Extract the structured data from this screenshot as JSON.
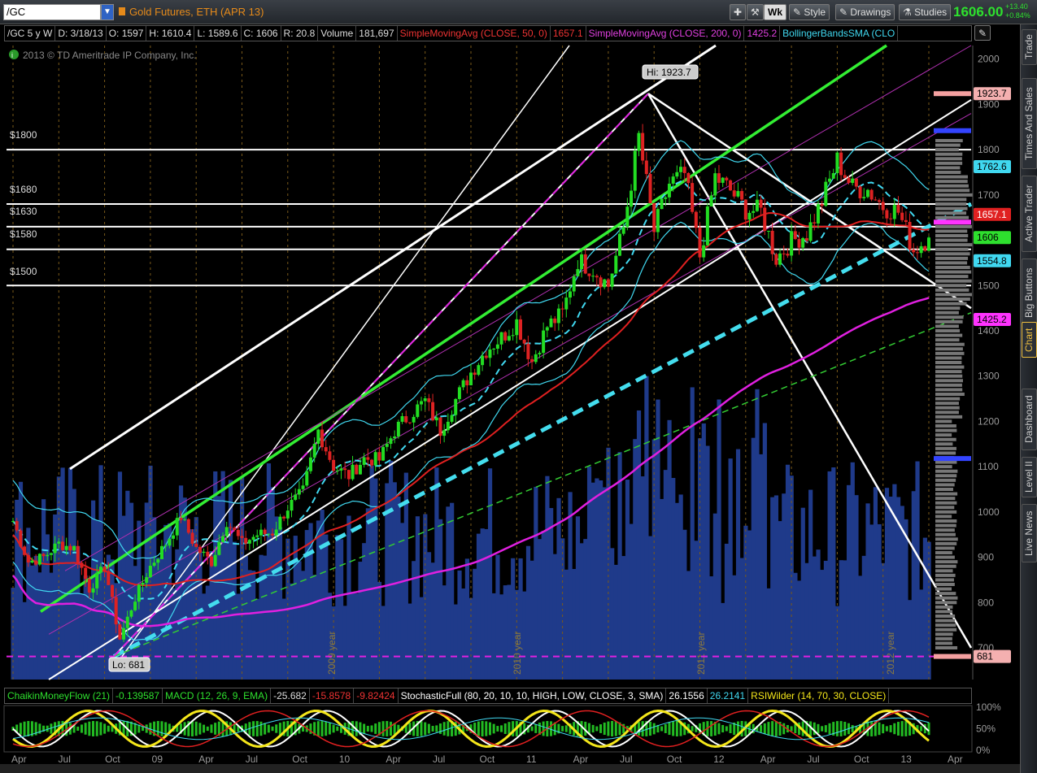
{
  "header": {
    "symbol": "/GC",
    "description": "Gold Futures, ETH (APR 13)",
    "wk_label": "Wk",
    "style_label": "Style",
    "drawings_label": "Drawings",
    "studies_label": "Studies",
    "last_price": "1606.00",
    "change_abs": "+13.40",
    "change_pct": "+0.84%"
  },
  "studies": {
    "symbol_period": "/GC 5 y W",
    "date": "D: 3/18/13",
    "open": "O: 1597",
    "high": "H: 1610.4",
    "low": "L: 1589.6",
    "close": "C: 1606",
    "range": "R: 20.8",
    "volume_label": "Volume",
    "volume_value": "181,697",
    "sma50_label": "SimpleMovingAvg (CLOSE, 50, 0)",
    "sma50_value": "1657.1",
    "sma200_label": "SimpleMovingAvg (CLOSE, 200, 0)",
    "sma200_value": "1425.2",
    "bb_label": "BollingerBandsSMA (CLO"
  },
  "copyright": "2013 © TD Ameritrade IP Company, Inc.",
  "lower_studies": {
    "cmf_label": "ChaikinMoneyFlow (21)",
    "cmf_value": "-0.139587",
    "macd_label": "MACD (12, 26, 9, EMA)",
    "macd_v1": "-25.682",
    "macd_v2": "-15.8578",
    "macd_v3": "-9.82424",
    "stoch_label": "StochasticFull (80, 20, 10, 10, HIGH, LOW, CLOSE, 3, SMA)",
    "stoch_v1": "26.1556",
    "stoch_v2": "26.2141",
    "rsi_label": "RSIWilder (14, 70, 30, CLOSE)",
    "lower_axis": [
      "100%",
      "50%",
      "0%"
    ]
  },
  "sidebar_tabs": [
    "Trade",
    "Times And Sales",
    "Active Trader",
    "Big Buttons",
    "Chart",
    "Dashboard",
    "Level II",
    "Live News"
  ],
  "price_axis": [
    "2000",
    "1900",
    "1800",
    "1700",
    "1600",
    "1500",
    "1400",
    "1300",
    "1200",
    "1100",
    "1000",
    "900",
    "800",
    "700"
  ],
  "price_tags": {
    "high": "1923.7",
    "bb_upper": "1762.6",
    "sma50": "1657.1",
    "last": "1606",
    "bb_lower": "1554.8",
    "sma200": "1425.2",
    "low": "681"
  },
  "level_labels": [
    "$1800",
    "$1680",
    "$1630",
    "$1580",
    "$1500"
  ],
  "annotations": {
    "hi": "Hi: 1923.7",
    "lo": "Lo: 681"
  },
  "year_labels": [
    "2009 year",
    "2010 year",
    "2011 year",
    "2012 year"
  ],
  "time_axis": [
    "Apr",
    "Jul",
    "Oct",
    "09",
    "Apr",
    "Jul",
    "Oct",
    "10",
    "Apr",
    "Jul",
    "Oct",
    "11",
    "Apr",
    "Jul",
    "Oct",
    "12",
    "Apr",
    "Jul",
    "Oct",
    "13",
    "Apr"
  ],
  "colors": {
    "up": "#22dd22",
    "down": "#dd2222",
    "volume": "#1f3a8a",
    "sma50": "#e02020",
    "sma200": "#e020e0",
    "bollinger": "#40d8f0",
    "trend_green": "#33ee33",
    "trend_cyan": "#44ddee"
  },
  "chart_data": {
    "type": "candlestick",
    "symbol": "/GC",
    "period": "5 y W",
    "y_range": [
      630,
      2030
    ],
    "x_start": "2008-03",
    "x_end": "2013-04",
    "close_series": [
      [
        "2008-03",
        980
      ],
      [
        "2008-04",
        890
      ],
      [
        "2008-05",
        900
      ],
      [
        "2008-06",
        930
      ],
      [
        "2008-07",
        920
      ],
      [
        "2008-08",
        830
      ],
      [
        "2008-09",
        880
      ],
      [
        "2008-10",
        720
      ],
      [
        "2008-11",
        810
      ],
      [
        "2008-12",
        880
      ],
      [
        "2009-01",
        930
      ],
      [
        "2009-02",
        990
      ],
      [
        "2009-03",
        920
      ],
      [
        "2009-04",
        890
      ],
      [
        "2009-05",
        980
      ],
      [
        "2009-06",
        930
      ],
      [
        "2009-07",
        950
      ],
      [
        "2009-08",
        955
      ],
      [
        "2009-09",
        1010
      ],
      [
        "2009-10",
        1045
      ],
      [
        "2009-11",
        1180
      ],
      [
        "2009-12",
        1100
      ],
      [
        "2010-01",
        1080
      ],
      [
        "2010-02",
        1118
      ],
      [
        "2010-03",
        1115
      ],
      [
        "2010-04",
        1180
      ],
      [
        "2010-05",
        1215
      ],
      [
        "2010-06",
        1245
      ],
      [
        "2010-07",
        1180
      ],
      [
        "2010-08",
        1248
      ],
      [
        "2010-09",
        1308
      ],
      [
        "2010-10",
        1358
      ],
      [
        "2010-11",
        1385
      ],
      [
        "2010-12",
        1420
      ],
      [
        "2011-01",
        1332
      ],
      [
        "2011-02",
        1410
      ],
      [
        "2011-03",
        1438
      ],
      [
        "2011-04",
        1556
      ],
      [
        "2011-05",
        1536
      ],
      [
        "2011-06",
        1500
      ],
      [
        "2011-07",
        1628
      ],
      [
        "2011-08",
        1828
      ],
      [
        "2011-09",
        1620
      ],
      [
        "2011-10",
        1725
      ],
      [
        "2011-11",
        1746
      ],
      [
        "2011-12",
        1565
      ],
      [
        "2012-01",
        1740
      ],
      [
        "2012-02",
        1710
      ],
      [
        "2012-03",
        1668
      ],
      [
        "2012-04",
        1664
      ],
      [
        "2012-05",
        1560
      ],
      [
        "2012-06",
        1598
      ],
      [
        "2012-07",
        1614
      ],
      [
        "2012-08",
        1686
      ],
      [
        "2012-09",
        1776
      ],
      [
        "2012-10",
        1716
      ],
      [
        "2012-11",
        1712
      ],
      [
        "2012-12",
        1675
      ],
      [
        "2013-01",
        1663
      ],
      [
        "2013-02",
        1578
      ],
      [
        "2013-03",
        1606
      ]
    ],
    "horizontal_levels": [
      1800,
      1680,
      1630,
      1580,
      1500
    ],
    "annotations": [
      {
        "label": "Hi: 1923.7",
        "date": "2011-09",
        "value": 1923.7
      },
      {
        "label": "Lo: 681",
        "date": "2008-10",
        "value": 681
      }
    ]
  }
}
